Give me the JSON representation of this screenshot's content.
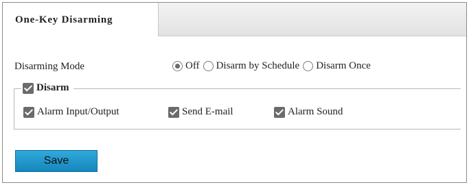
{
  "tab": {
    "label": "One-Key Disarming"
  },
  "disarming_mode": {
    "label": "Disarming Mode",
    "options": [
      {
        "label": "Off",
        "checked": true
      },
      {
        "label": "Disarm by Schedule",
        "checked": false
      },
      {
        "label": "Disarm Once",
        "checked": false
      }
    ]
  },
  "disarm": {
    "label": "Disarm",
    "checked": true,
    "items": [
      {
        "label": "Alarm Input/Output",
        "checked": true
      },
      {
        "label": "Send E-mail",
        "checked": true
      },
      {
        "label": "Alarm Sound",
        "checked": true
      }
    ]
  },
  "actions": {
    "save_label": "Save"
  },
  "colors": {
    "accent": "#1f9bd0",
    "checkbox": "#6b6b6b"
  }
}
